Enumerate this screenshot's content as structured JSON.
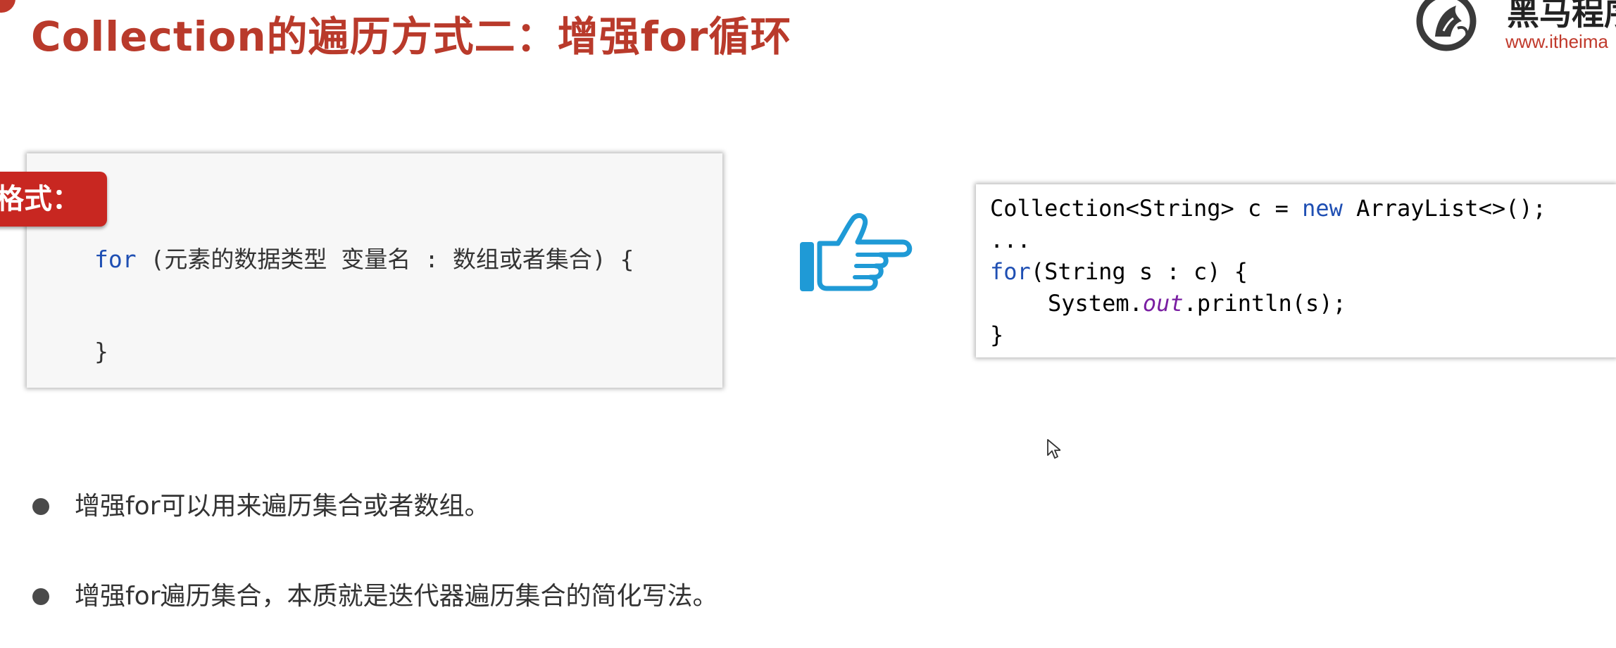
{
  "header": {
    "title": "Collection的遍历方式二：增强for循环"
  },
  "logo": {
    "name": "黑马程序",
    "url": "www.itheima"
  },
  "syntax_card": {
    "label": "格式：",
    "line1_keyword": "for",
    "line1_rest": " (元素的数据类型 变量名 : 数组或者集合) {",
    "line2": "}"
  },
  "pointer": {
    "icon": "pointing-hand-icon",
    "color": "#1f9ad6"
  },
  "code_example": {
    "line1_a": "Collection<String> c = ",
    "line1_kw": "new",
    "line1_b": " ArrayList<>();",
    "line2": "...",
    "line3_kw": "for",
    "line3_rest": "(String s : c) {",
    "line4_a": "System.",
    "line4_field": "out",
    "line4_b": ".println(s);",
    "line5": "}"
  },
  "bullets": [
    "增强for可以用来遍历集合或者数组。",
    "增强for遍历集合，本质就是迭代器遍历集合的简化写法。"
  ],
  "colors": {
    "title": "#b93a2b",
    "label_bg": "#c82721",
    "keyword": "#1f4fb3",
    "field": "#7a1fa2"
  }
}
